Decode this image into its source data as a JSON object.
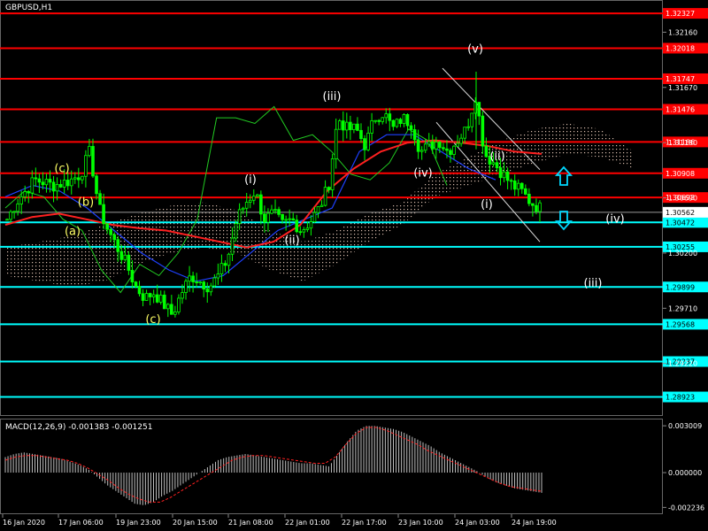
{
  "window": {
    "title": "GBPUSD,H1",
    "macd_label": "MACD(12,26,9) -0.001383 -0.001251"
  },
  "colors": {
    "background": "#000000",
    "price_candle": "#00ff00",
    "level_red": "#ff0000",
    "level_cyan": "#00ffff",
    "ma_red": "#ff2020",
    "ma_blue": "#1e40ff",
    "chikou_green": "#22cc22",
    "cloud_dots": "#f0d0c0",
    "macd_hist": "#c0c0c0",
    "macd_signal": "#ff2020",
    "wave_yellow": "#ffff66",
    "wave_white": "#ffffff",
    "arrow": "#00d8ff"
  },
  "chart_data": {
    "type": "candlestick",
    "symbol": "GBPUSD",
    "timeframe": "H1",
    "ylim": [
      1.2877,
      1.3243
    ],
    "price_axis_ticks": [
      "1.32160",
      "1.31670",
      "1.31180",
      "1.30690",
      "1.30200",
      "1.29710",
      "1.29220"
    ],
    "time_axis_ticks": [
      "16 Jan 2020",
      "17 Jan 06:00",
      "19 Jan 23:00",
      "20 Jan 15:00",
      "21 Jan 08:00",
      "22 Jan 01:00",
      "22 Jan 17:00",
      "23 Jan 10:00",
      "24 Jan 03:00",
      "24 Jan 19:00"
    ],
    "current_price": {
      "value": 1.30562,
      "label": "1.30562"
    },
    "levels_red": [
      {
        "value": 1.32327,
        "label": "1.32327"
      },
      {
        "value": 1.32018,
        "label": "1.32018"
      },
      {
        "value": 1.31747,
        "label": "1.31747"
      },
      {
        "value": 1.31476,
        "label": "1.31476"
      },
      {
        "value": 1.31186,
        "label": "1.31186"
      },
      {
        "value": 1.30908,
        "label": "1.30908"
      },
      {
        "value": 1.30693,
        "label": "1.30693"
      }
    ],
    "levels_cyan": [
      {
        "value": 1.30472,
        "label": "1.30472"
      },
      {
        "value": 1.30255,
        "label": "1.30255"
      },
      {
        "value": 1.29899,
        "label": "1.29899"
      },
      {
        "value": 1.29568,
        "label": "1.29568"
      },
      {
        "value": 1.29237,
        "label": "1.29237"
      },
      {
        "value": 1.28923,
        "label": "1.28923"
      }
    ],
    "price_path": [
      1.305,
      1.3065,
      1.3075,
      1.3085,
      1.3083,
      1.308,
      1.3082,
      1.3085,
      1.309,
      1.311,
      1.306,
      1.304,
      1.3025,
      1.301,
      1.299,
      1.298,
      1.2985,
      1.2975,
      1.2965,
      1.2985,
      1.3,
      1.2995,
      1.299,
      1.3,
      1.3015,
      1.305,
      1.3065,
      1.3075,
      1.305,
      1.3055,
      1.3045,
      1.305,
      1.304,
      1.3048,
      1.306,
      1.308,
      1.314,
      1.313,
      1.313,
      1.3115,
      1.314,
      1.3145,
      1.313,
      1.314,
      1.3135,
      1.311,
      1.3115,
      1.312,
      1.311,
      1.312,
      1.313,
      1.316,
      1.3108,
      1.31,
      1.309,
      1.308,
      1.3075,
      1.3065,
      1.306
    ],
    "ma_red_path": [
      1.3045,
      1.3052,
      1.3055,
      1.305,
      1.3045,
      1.3042,
      1.304,
      1.3035,
      1.303,
      1.3025,
      1.303,
      1.3045,
      1.3075,
      1.3095,
      1.311,
      1.3118,
      1.312,
      1.3118,
      1.3115,
      1.311,
      1.3108
    ],
    "ma_blue_path": [
      1.307,
      1.308,
      1.3075,
      1.306,
      1.304,
      1.302,
      1.3005,
      1.2995,
      1.3,
      1.302,
      1.304,
      1.305,
      1.306,
      1.311,
      1.3125,
      1.3125,
      1.311,
      1.3095,
      1.3085
    ],
    "chikou_path": [
      1.306,
      1.3075,
      1.307,
      1.305,
      1.304,
      1.3005,
      1.2985,
      1.301,
      1.3,
      1.302,
      1.305,
      1.314,
      1.314,
      1.3135,
      1.315,
      1.312,
      1.3125,
      1.311,
      1.309,
      1.3085,
      1.31,
      1.313,
      1.312,
      1.308
    ],
    "cloud_upper": [
      1.3025,
      1.303,
      1.3035,
      1.3045,
      1.3055,
      1.3062,
      1.3065,
      1.3058,
      1.304,
      1.303,
      1.304,
      1.3055,
      1.3065,
      1.309,
      1.3105,
      1.312,
      1.313,
      1.3135,
      1.313,
      1.311
    ],
    "cloud_lower": [
      1.3,
      1.2995,
      1.299,
      1.2995,
      1.301,
      1.302,
      1.3025,
      1.302,
      1.3005,
      1.2995,
      1.301,
      1.303,
      1.3045,
      1.307,
      1.308,
      1.309,
      1.31,
      1.3108,
      1.3105,
      1.3095
    ],
    "waves": [
      {
        "label": "(c)",
        "color": "yellow",
        "price": 1.3092
      },
      {
        "label": "(b)",
        "color": "yellow",
        "price": 1.3062
      },
      {
        "label": "(a)",
        "color": "yellow",
        "price": 1.3036
      },
      {
        "label": "(c)",
        "color": "yellow",
        "price": 1.2958
      },
      {
        "label": "(i)",
        "color": "white",
        "price": 1.3082
      },
      {
        "label": "(ii)",
        "color": "white",
        "price": 1.3028
      },
      {
        "label": "(iii)",
        "color": "white",
        "price": 1.3156
      },
      {
        "label": "(iv)",
        "color": "white",
        "price": 1.3088
      },
      {
        "label": "(v)",
        "color": "white",
        "price": 1.3198
      },
      {
        "label": "(i)",
        "color": "white",
        "price": 1.306
      },
      {
        "label": "(ii)",
        "color": "white",
        "price": 1.3103
      },
      {
        "label": "(iv)",
        "color": "white",
        "price": 1.3047
      },
      {
        "label": "(iii)",
        "color": "white",
        "price": 1.299
      }
    ],
    "macd": {
      "ylim": [
        -0.0025,
        0.0033
      ],
      "ticks": [
        "0.003009",
        "0.000000",
        "-0.002236"
      ],
      "histogram": [
        0.001,
        0.0012,
        0.0013,
        0.0012,
        0.0011,
        0.001,
        0.0009,
        0.0007,
        0.0005,
        0.0002,
        -0.0003,
        -0.0008,
        -0.0012,
        -0.0016,
        -0.002,
        -0.0021,
        -0.0019,
        -0.0015,
        -0.0012,
        -0.0008,
        -0.0004,
        0.0,
        0.0004,
        0.0008,
        0.001,
        0.0011,
        0.0012,
        0.0011,
        0.001,
        0.0009,
        0.0008,
        0.0007,
        0.0006,
        0.0006,
        0.0005,
        0.0004,
        0.0012,
        0.002,
        0.0027,
        0.003,
        0.003,
        0.0029,
        0.0028,
        0.0026,
        0.0023,
        0.002,
        0.0017,
        0.0013,
        0.001,
        0.0007,
        0.0004,
        0.0001,
        -0.0003,
        -0.0006,
        -0.0008,
        -0.001,
        -0.0011,
        -0.0012,
        -0.0013
      ],
      "signal": [
        0.0008,
        0.001,
        0.0011,
        0.0011,
        0.001,
        0.0009,
        0.0008,
        0.0006,
        0.0003,
        -0.0001,
        -0.0005,
        -0.001,
        -0.0014,
        -0.0017,
        -0.0019,
        -0.0019,
        -0.0016,
        -0.0012,
        -0.0008,
        -0.0004,
        0.0,
        0.0004,
        0.0008,
        0.001,
        0.0011,
        0.0011,
        0.001,
        0.0009,
        0.0008,
        0.0007,
        0.0006,
        0.0006,
        0.001,
        0.0018,
        0.0025,
        0.0029,
        0.0029,
        0.0027,
        0.0024,
        0.0021,
        0.0018,
        0.0014,
        0.0011,
        0.0008,
        0.0005,
        0.0002,
        -0.0001,
        -0.0004,
        -0.0007,
        -0.0009,
        -0.001,
        -0.0011,
        -0.0012
      ]
    }
  }
}
